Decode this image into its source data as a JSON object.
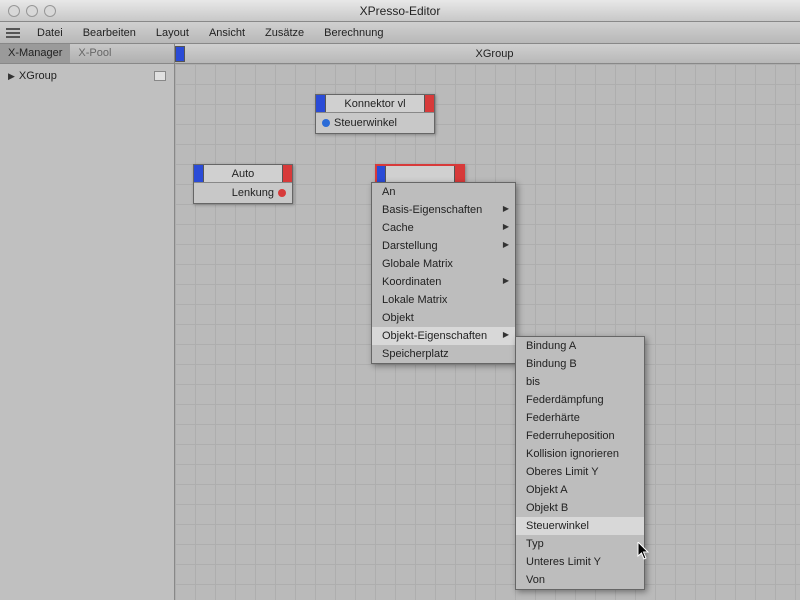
{
  "window": {
    "title": "XPresso-Editor"
  },
  "menu": {
    "items": [
      "Datei",
      "Bearbeiten",
      "Layout",
      "Ansicht",
      "Zusätze",
      "Berechnung"
    ]
  },
  "sidebar": {
    "tabs": [
      {
        "label": "X-Manager",
        "active": true
      },
      {
        "label": "X-Pool",
        "active": false
      }
    ],
    "tree": {
      "root": "XGroup"
    }
  },
  "canvas": {
    "title": "XGroup"
  },
  "nodes": {
    "konnektor": {
      "title": "Konnektor vl",
      "port": "Steuerwinkel"
    },
    "auto": {
      "title": "Auto",
      "port": "Lenkung"
    },
    "selected": {
      "title": ""
    }
  },
  "context_menu": {
    "items": [
      {
        "label": "An",
        "submenu": false
      },
      {
        "label": "Basis-Eigenschaften",
        "submenu": true
      },
      {
        "label": "Cache",
        "submenu": true
      },
      {
        "label": "Darstellung",
        "submenu": true
      },
      {
        "label": "Globale Matrix",
        "submenu": false
      },
      {
        "label": "Koordinaten",
        "submenu": true
      },
      {
        "label": "Lokale Matrix",
        "submenu": false
      },
      {
        "label": "Objekt",
        "submenu": false
      },
      {
        "label": "Objekt-Eigenschaften",
        "submenu": true,
        "hover": true
      },
      {
        "label": "Speicherplatz",
        "submenu": false
      }
    ],
    "submenu_items": [
      "Bindung A",
      "Bindung B",
      "bis",
      "Federdämpfung",
      "Federhärte",
      "Federruheposition",
      "Kollision ignorieren",
      "Oberes Limit Y",
      "Objekt A",
      "Objekt B",
      "Steuerwinkel",
      "Typ",
      "Unteres Limit Y",
      "Von"
    ],
    "submenu_hover": "Steuerwinkel"
  }
}
